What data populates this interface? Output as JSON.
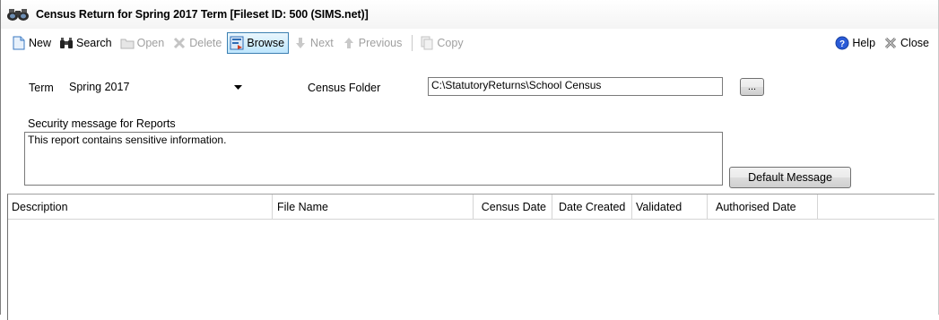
{
  "window": {
    "title": "Census Return for Spring 2017 Term [Fileset ID: 500 (SIMS.net)]",
    "icon": "binoculars-icon"
  },
  "toolbar": {
    "new_label": "New",
    "search_label": "Search",
    "open_label": "Open",
    "delete_label": "Delete",
    "browse_label": "Browse",
    "next_label": "Next",
    "previous_label": "Previous",
    "copy_label": "Copy",
    "help_label": "Help",
    "close_label": "Close"
  },
  "form": {
    "term_label": "Term",
    "term_value": "Spring 2017",
    "census_folder_label": "Census Folder",
    "census_folder_value": "C:\\StatutoryReturns\\School Census",
    "browse_folder_label": "...",
    "security_label": "Security message for Reports",
    "security_message": "This report contains sensitive information.",
    "default_message_label": "Default Message"
  },
  "grid": {
    "columns": [
      "Description",
      "File Name",
      "Census Date",
      "Date Created",
      "Validated",
      "Authorised Date"
    ],
    "rows": []
  },
  "colors": {
    "active_button_border": "#3c7fb1",
    "help_icon": "#2a5bd7"
  }
}
